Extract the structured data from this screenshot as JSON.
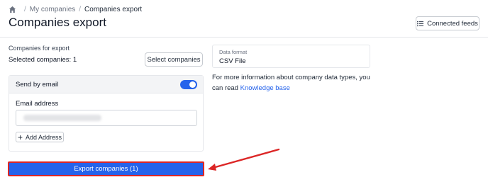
{
  "breadcrumb": {
    "items": [
      "My companies",
      "Companies export"
    ],
    "separator": "/"
  },
  "page": {
    "title": "Companies export"
  },
  "header": {
    "connected_feeds_label": "Connected feeds"
  },
  "export_section": {
    "label": "Companies for export",
    "selected_text": "Selected companies: 1",
    "select_button_label": "Select companies"
  },
  "email_card": {
    "send_by_email_label": "Send by email",
    "send_by_email_enabled": true,
    "email_label": "Email address",
    "add_address_label": "Add Address"
  },
  "export_button_label": "Export companies (1)",
  "format": {
    "label": "Data format",
    "value": "CSV File"
  },
  "info": {
    "text": "For more information about company data types, you can read",
    "link_label": "Knowledge base"
  },
  "colors": {
    "accent": "#2563eb",
    "highlight": "#dc2626"
  },
  "icons": {
    "home": "home-icon",
    "feeds": "list-icon",
    "add": "plus-icon"
  }
}
